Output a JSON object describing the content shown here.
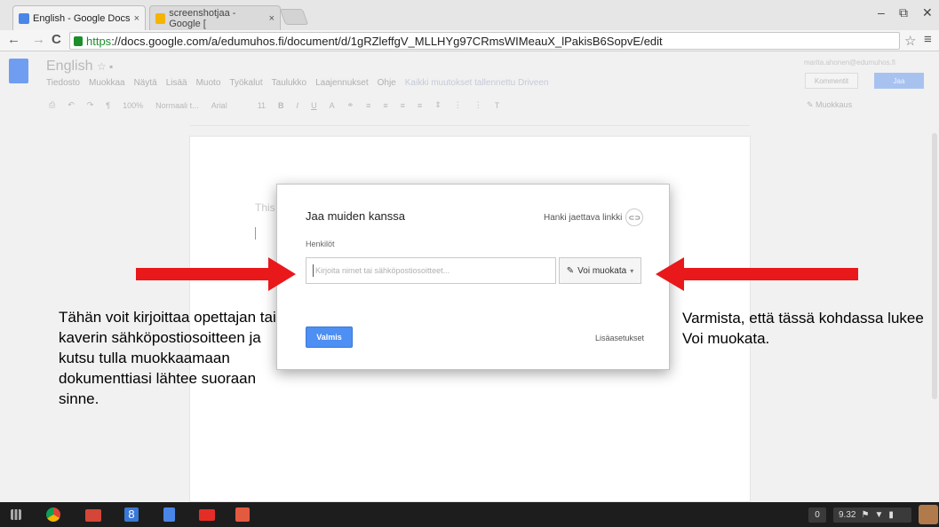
{
  "browser": {
    "tabs": [
      {
        "title": "English - Google Docs",
        "close": "×"
      },
      {
        "title": "screenshotjaa - Google [",
        "close": "×"
      }
    ],
    "window_controls": {
      "minimize": "–",
      "restore": "⧉",
      "close": "✕"
    },
    "nav": {
      "back": "←",
      "forward": "→",
      "reload": "C"
    },
    "url": {
      "scheme": "https",
      "rest": "://docs.google.com/a/edumuhos.fi/document/d/1gRZleffgV_MLLHYg97CRmsWIMeauX_lPakisB6SopvE/edit"
    },
    "star": "☆",
    "menu": "≡"
  },
  "docs": {
    "title": "English",
    "menus": [
      "Tiedosto",
      "Muokkaa",
      "Näytä",
      "Lisää",
      "Muoto",
      "Työkalut",
      "Taulukko",
      "Laajennukset",
      "Ohje"
    ],
    "save_status": "Kaikki muutokset tallennettu Driveen",
    "account": "marita.ahonen@edumuhos.fi",
    "comments_button": "Kommentit",
    "share_button": "Jaa",
    "toolbar": {
      "zoom": "100%",
      "style": "Normaali t...",
      "font": "Arial",
      "size": "11"
    },
    "editing_mode": "Muokkaus",
    "page_text": "This"
  },
  "share_dialog": {
    "title": "Jaa muiden kanssa",
    "get_link": "Hanki jaettava linkki",
    "people_label": "Henkilöt",
    "input_placeholder": "Kirjoita nimet tai sähköpostiosoitteet...",
    "permission": "Voi muokata",
    "done_button": "Valmis",
    "advanced": "Lisäasetukset"
  },
  "annotations": {
    "left_note": "Tähän voit kirjoittaa opettajan tai kaverin sähköpostiosoitteen ja kutsu tulla muokkaamaan dokumenttiasi lähtee suoraan sinne.",
    "right_note": "Varmista, että tässä kohdassa lukee Voi muokata.",
    "arrow_color": "#e8181b"
  },
  "taskbar": {
    "apps": [
      "launcher-icon",
      "chrome-icon",
      "gmail-icon",
      "google-plus-icon",
      "docs-icon",
      "youtube-icon",
      "photos-icon"
    ],
    "notification_count": "0",
    "time": "9.32"
  }
}
